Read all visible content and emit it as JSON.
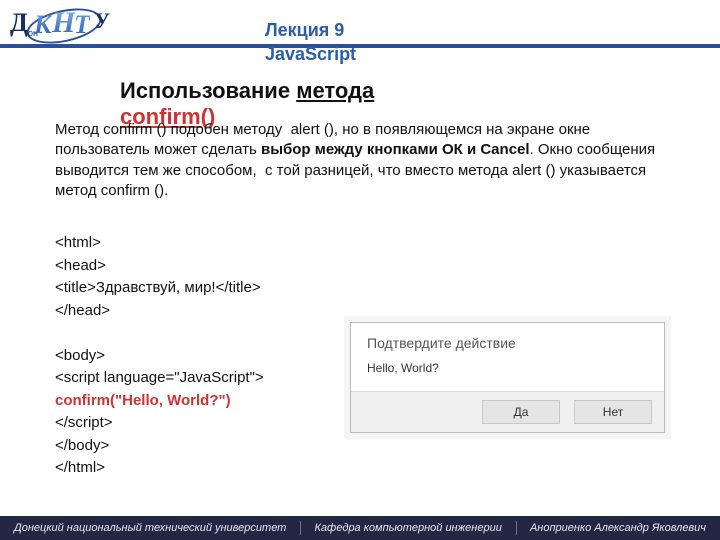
{
  "header": {
    "lecture": "Лекция 9",
    "subject": "JavaScript",
    "logo": {
      "d": "Д",
      "k": "К",
      "h": "Н",
      "t": "Т",
      "u": "У",
      "on": "он"
    }
  },
  "title": {
    "prefix": "Использование ",
    "method_word": "метода",
    "confirm": "confirm()"
  },
  "paragraph": "Метод confirm () подобен методу  alert (), но в появляющемся на экране окне пользователь может сделать выбор между кнопками ОК и Cancel. Окно сообщения выводится тем же способом,  с той разницей, что вместо метода alert () указывается метод confirm ().",
  "code": {
    "l1": "<html>",
    "l2": "<head>",
    "l3": "<title>Здравствуй, мир!</title>",
    "l4": "</head>",
    "l5": "",
    "l6": "<body>",
    "l7": "<script language=\"JavaScript\">",
    "l8": "confirm(\"Hello, World?\")",
    "l9": "</scr",
    "l9b": "ipt>",
    "l10": "</body>",
    "l11": "</html>"
  },
  "dialog": {
    "title": "Подтвердите действие",
    "message": "Hello, World?",
    "yes": "Да",
    "no": "Нет"
  },
  "footer": {
    "left": "Донецкий национальный технический университет",
    "center": "Кафедра компьютерной инженерии",
    "right": "Аноприенко Александр Яковлевич"
  }
}
